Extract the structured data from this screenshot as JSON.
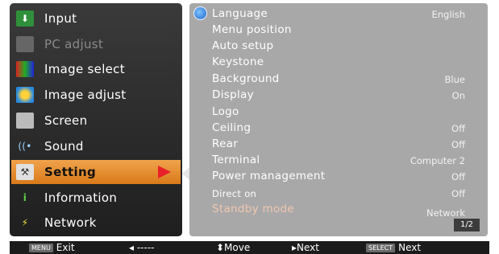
{
  "main_menu": [
    {
      "label": "Input",
      "icon": "input-arrow-icon",
      "state": "normal"
    },
    {
      "label": "PC adjust",
      "icon": "pc-adjust-icon",
      "state": "disabled"
    },
    {
      "label": "Image select",
      "icon": "image-select-icon",
      "state": "normal"
    },
    {
      "label": "Image adjust",
      "icon": "image-adjust-icon",
      "state": "normal"
    },
    {
      "label": "Screen",
      "icon": "screen-icon",
      "state": "normal"
    },
    {
      "label": "Sound",
      "icon": "sound-icon",
      "state": "normal"
    },
    {
      "label": "Setting",
      "icon": "setting-icon",
      "state": "selected"
    },
    {
      "label": "Information",
      "icon": "information-icon",
      "state": "normal"
    },
    {
      "label": "Network",
      "icon": "network-icon",
      "state": "normal"
    }
  ],
  "submenu": {
    "items": [
      {
        "label": "Language",
        "value": "English"
      },
      {
        "label": "Menu position",
        "value": ""
      },
      {
        "label": "Auto setup",
        "value": ""
      },
      {
        "label": "Keystone",
        "value": ""
      },
      {
        "label": "Background",
        "value": "Blue"
      },
      {
        "label": "Display",
        "value": "On"
      },
      {
        "label": "Logo",
        "value": ""
      },
      {
        "label": "Ceiling",
        "value": "Off"
      },
      {
        "label": "Rear",
        "value": "Off"
      },
      {
        "label": "Terminal",
        "value": "Computer 2"
      },
      {
        "label": "Power management",
        "value": "Off"
      },
      {
        "label": "Direct on",
        "value": "Off"
      },
      {
        "label": "Standby mode",
        "value": "Network"
      }
    ],
    "page": "1/2"
  },
  "help_bar": {
    "menu_key": "MENU",
    "exit": "Exit",
    "back": "◂ -----",
    "move": "⬍Move",
    "next1": "▸Next",
    "select_key": "SELECT",
    "next2": "Next"
  },
  "colors": {
    "selected_accent": "#e8902c",
    "arrow": "#e8202a",
    "submenu_bg": "#a8a8a8",
    "menu_bg": "#2a2a2a"
  }
}
